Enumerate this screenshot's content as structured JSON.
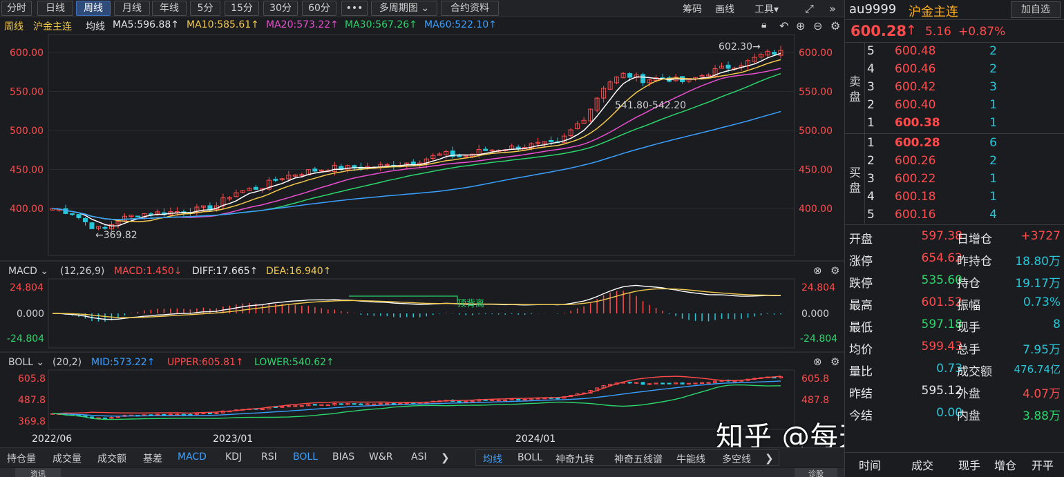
{
  "toolbar": {
    "periods": [
      "分时",
      "日线",
      "周线",
      "月线",
      "年线",
      "5分",
      "15分",
      "30分",
      "60分",
      "•••",
      "多周期图 ⌄",
      "合约资料"
    ],
    "active_index": 2,
    "right": [
      "筹码",
      "画线",
      "工具▾"
    ]
  },
  "ma_line": {
    "period": "周线",
    "contract": "沪金主连",
    "label": "均线",
    "ma5": "MA5:596.88↑",
    "ma10": "MA10:585.61↑",
    "ma20": "MA20:573.22↑",
    "ma30": "MA30:567.26↑",
    "ma60": "MA60:522.10↑"
  },
  "main_chart": {
    "y_ticks": [
      "600.00",
      "550.00",
      "500.00",
      "450.00",
      "400.00"
    ],
    "annot_high": "602.30→",
    "annot_low": "←369.82",
    "annot_mid": "541.80-542.20"
  },
  "macd": {
    "title": "MACD ⌄",
    "params": "(12,26,9)",
    "macd": "MACD:1.450↓",
    "diff": "DIFF:17.665↑",
    "dea": "DEA:16.940↑",
    "ticks": [
      "24.804",
      "0.000",
      "-24.804"
    ],
    "divergence": "顶背离"
  },
  "boll": {
    "title": "BOLL ⌄",
    "params": "(20,2)",
    "mid": "MID:573.22↑",
    "upper": "UPPER:605.81↑",
    "lower": "LOWER:540.62↑",
    "ticks": [
      "605.8",
      "487.8",
      "369.8"
    ]
  },
  "x_axis": [
    "2022/06",
    "2023/01",
    "2024/01"
  ],
  "bottom_tabs_left": [
    "持仓量",
    "成交量",
    "成交额",
    "基差",
    "MACD",
    "KDJ",
    "RSI",
    "BOLL",
    "BIAS",
    "W&R",
    "ASI"
  ],
  "bottom_tabs_right": [
    "均线",
    "BOLL",
    "神奇九转",
    "神奇五线谱",
    "牛能线",
    "多空线"
  ],
  "bottom_status": {
    "left": "资讯",
    "right": "诊股"
  },
  "watermark": "知乎 @每天学点投资学",
  "quote": {
    "symbol": "au9999",
    "name": "沪金主连",
    "add_fav": "加自选",
    "price": "600.28",
    "arrow": "↑",
    "change": "5.16",
    "pct": "+0.87%",
    "sell_label": "卖盘",
    "buy_label": "买盘",
    "asks": [
      {
        "lvl": "5",
        "price": "600.48",
        "vol": "2"
      },
      {
        "lvl": "4",
        "price": "600.46",
        "vol": "2"
      },
      {
        "lvl": "3",
        "price": "600.42",
        "vol": "3"
      },
      {
        "lvl": "2",
        "price": "600.40",
        "vol": "1"
      },
      {
        "lvl": "1",
        "price": "600.38",
        "vol": "1"
      }
    ],
    "bids": [
      {
        "lvl": "1",
        "price": "600.28",
        "vol": "6"
      },
      {
        "lvl": "2",
        "price": "600.26",
        "vol": "2"
      },
      {
        "lvl": "3",
        "price": "600.22",
        "vol": "1"
      },
      {
        "lvl": "4",
        "price": "600.18",
        "vol": "1"
      },
      {
        "lvl": "5",
        "price": "600.16",
        "vol": "4"
      }
    ],
    "stats": [
      {
        "k1": "开盘",
        "v1": "597.38",
        "k2": "日增仓",
        "v2": "+3727"
      },
      {
        "k1": "涨停",
        "v1": "654.62",
        "k2": "昨持仓",
        "v2": "18.80万"
      },
      {
        "k1": "跌停",
        "v1": "535.60",
        "k2": "持仓",
        "v2": "19.17万"
      },
      {
        "k1": "最高",
        "v1": "601.52",
        "k2": "振幅",
        "v2": "0.73%"
      },
      {
        "k1": "最低",
        "v1": "597.18",
        "k2": "现手",
        "v2": "8"
      },
      {
        "k1": "均价",
        "v1": "599.43",
        "k2": "总手",
        "v2": "7.95万"
      },
      {
        "k1": "量比",
        "v1": "0.73",
        "k2": "成交额",
        "v2": "476.74亿"
      },
      {
        "k1": "昨结",
        "v1": "595.12",
        "k2": "外盘",
        "v2": "4.07万"
      },
      {
        "k1": "今结",
        "v1": "0.00",
        "k2": "内盘",
        "v2": "3.88万"
      }
    ],
    "trade_head": [
      "时间",
      "成交",
      "现手",
      "增仓",
      "开平"
    ]
  },
  "colors": {
    "up": "#ff4b4b",
    "down": "#27c7d9",
    "ma5": "#ffffff",
    "ma10": "#f2c94c",
    "ma20": "#e94fd0",
    "ma30": "#2bd66b",
    "ma60": "#3aa0ff"
  }
}
